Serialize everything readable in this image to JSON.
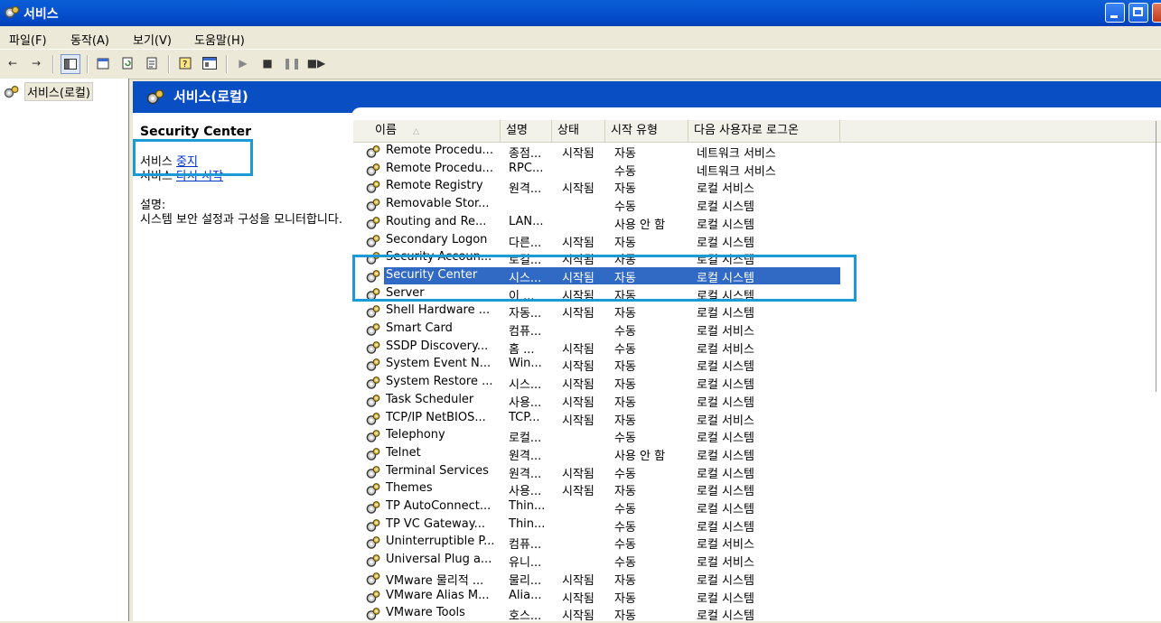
{
  "window": {
    "title": "서비스"
  },
  "menu": [
    "파일(F)",
    "동작(A)",
    "보기(V)",
    "도움말(H)"
  ],
  "tree": {
    "node_label": "서비스(로컬)"
  },
  "pane_header": {
    "title": "서비스(로컬)"
  },
  "description": {
    "service_name": "Security Center",
    "action1_prefix": "서비스 ",
    "action1_link": "중지",
    "action2_prefix": "서비스 ",
    "action2_link": "다시 시작",
    "desc_label": "설명:",
    "desc_text": "시스템 보안 설정과 구성을 모니터합니다."
  },
  "columns": {
    "name": "이름",
    "description": "설명",
    "status": "상태",
    "startup": "시작 유형",
    "logon": "다음 사용자로 로그온"
  },
  "services": [
    {
      "name": "Remote Procedu...",
      "desc": "종점...",
      "status": "시작됨",
      "startup": "자동",
      "logon": "네트워크 서비스"
    },
    {
      "name": "Remote Procedu...",
      "desc": "RPC...",
      "status": "",
      "startup": "수동",
      "logon": "네트워크 서비스"
    },
    {
      "name": "Remote Registry",
      "desc": "원격...",
      "status": "시작됨",
      "startup": "자동",
      "logon": "로컬 서비스"
    },
    {
      "name": "Removable Stor...",
      "desc": "",
      "status": "",
      "startup": "수동",
      "logon": "로컬 시스템"
    },
    {
      "name": "Routing and Re...",
      "desc": "LAN...",
      "status": "",
      "startup": "사용 안 함",
      "logon": "로컬 시스템"
    },
    {
      "name": "Secondary Logon",
      "desc": "다른...",
      "status": "시작됨",
      "startup": "자동",
      "logon": "로컬 시스템"
    },
    {
      "name": "Security Accoun...",
      "desc": "로컬...",
      "status": "시작됨",
      "startup": "자동",
      "logon": "로컬 시스템"
    },
    {
      "name": "Security Center",
      "desc": "시스...",
      "status": "시작됨",
      "startup": "자동",
      "logon": "로컬 시스템",
      "selected": true
    },
    {
      "name": "Server",
      "desc": "이 ...",
      "status": "시작됨",
      "startup": "자동",
      "logon": "로컬 시스템"
    },
    {
      "name": "Shell Hardware ...",
      "desc": "자동...",
      "status": "시작됨",
      "startup": "자동",
      "logon": "로컬 시스템"
    },
    {
      "name": "Smart Card",
      "desc": "컴퓨...",
      "status": "",
      "startup": "수동",
      "logon": "로컬 서비스"
    },
    {
      "name": "SSDP Discovery...",
      "desc": "홈 ...",
      "status": "시작됨",
      "startup": "수동",
      "logon": "로컬 서비스"
    },
    {
      "name": "System Event N...",
      "desc": "Win...",
      "status": "시작됨",
      "startup": "자동",
      "logon": "로컬 시스템"
    },
    {
      "name": "System Restore ...",
      "desc": "시스...",
      "status": "시작됨",
      "startup": "자동",
      "logon": "로컬 시스템"
    },
    {
      "name": "Task Scheduler",
      "desc": "사용...",
      "status": "시작됨",
      "startup": "자동",
      "logon": "로컬 시스템"
    },
    {
      "name": "TCP/IP NetBIOS...",
      "desc": "TCP...",
      "status": "시작됨",
      "startup": "자동",
      "logon": "로컬 서비스"
    },
    {
      "name": "Telephony",
      "desc": "로컬...",
      "status": "",
      "startup": "수동",
      "logon": "로컬 시스템"
    },
    {
      "name": "Telnet",
      "desc": "원격...",
      "status": "",
      "startup": "사용 안 함",
      "logon": "로컬 시스템"
    },
    {
      "name": "Terminal Services",
      "desc": "원격...",
      "status": "시작됨",
      "startup": "수동",
      "logon": "로컬 시스템"
    },
    {
      "name": "Themes",
      "desc": "사용...",
      "status": "시작됨",
      "startup": "자동",
      "logon": "로컬 시스템"
    },
    {
      "name": "TP AutoConnect...",
      "desc": "Thin...",
      "status": "",
      "startup": "수동",
      "logon": "로컬 시스템"
    },
    {
      "name": "TP VC Gateway...",
      "desc": "Thin...",
      "status": "",
      "startup": "수동",
      "logon": "로컬 시스템"
    },
    {
      "name": "Uninterruptible P...",
      "desc": "컴퓨...",
      "status": "",
      "startup": "수동",
      "logon": "로컬 서비스"
    },
    {
      "name": "Universal Plug a...",
      "desc": "유니...",
      "status": "",
      "startup": "수동",
      "logon": "로컬 서비스"
    },
    {
      "name": "VMware 물리적 ...",
      "desc": "물리...",
      "status": "시작됨",
      "startup": "자동",
      "logon": "로컬 시스템"
    },
    {
      "name": "VMware Alias M...",
      "desc": "Alia...",
      "status": "시작됨",
      "startup": "자동",
      "logon": "로컬 시스템"
    },
    {
      "name": "VMware Tools",
      "desc": "호스...",
      "status": "시작됨",
      "startup": "자동",
      "logon": "로컬 시스템"
    }
  ]
}
